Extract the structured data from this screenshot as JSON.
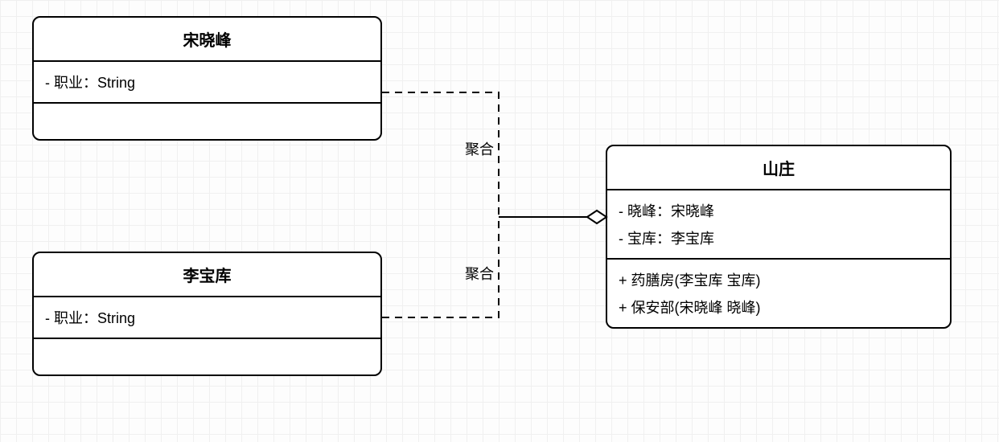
{
  "classes": {
    "song": {
      "name": "宋晓峰",
      "attributes": [
        "- 职业：String"
      ],
      "methods": []
    },
    "li": {
      "name": "李宝库",
      "attributes": [
        "- 职业：String"
      ],
      "methods": []
    },
    "villa": {
      "name": "山庄",
      "attributes": [
        "- 晓峰：宋晓峰",
        "- 宝库：李宝库"
      ],
      "methods": [
        "+ 药膳房(李宝库 宝库)",
        "+ 保安部(宋晓峰 晓峰)"
      ]
    }
  },
  "edges": {
    "song_villa": {
      "label": "聚合",
      "type": "aggregation"
    },
    "li_villa": {
      "label": "聚合",
      "type": "aggregation"
    }
  }
}
